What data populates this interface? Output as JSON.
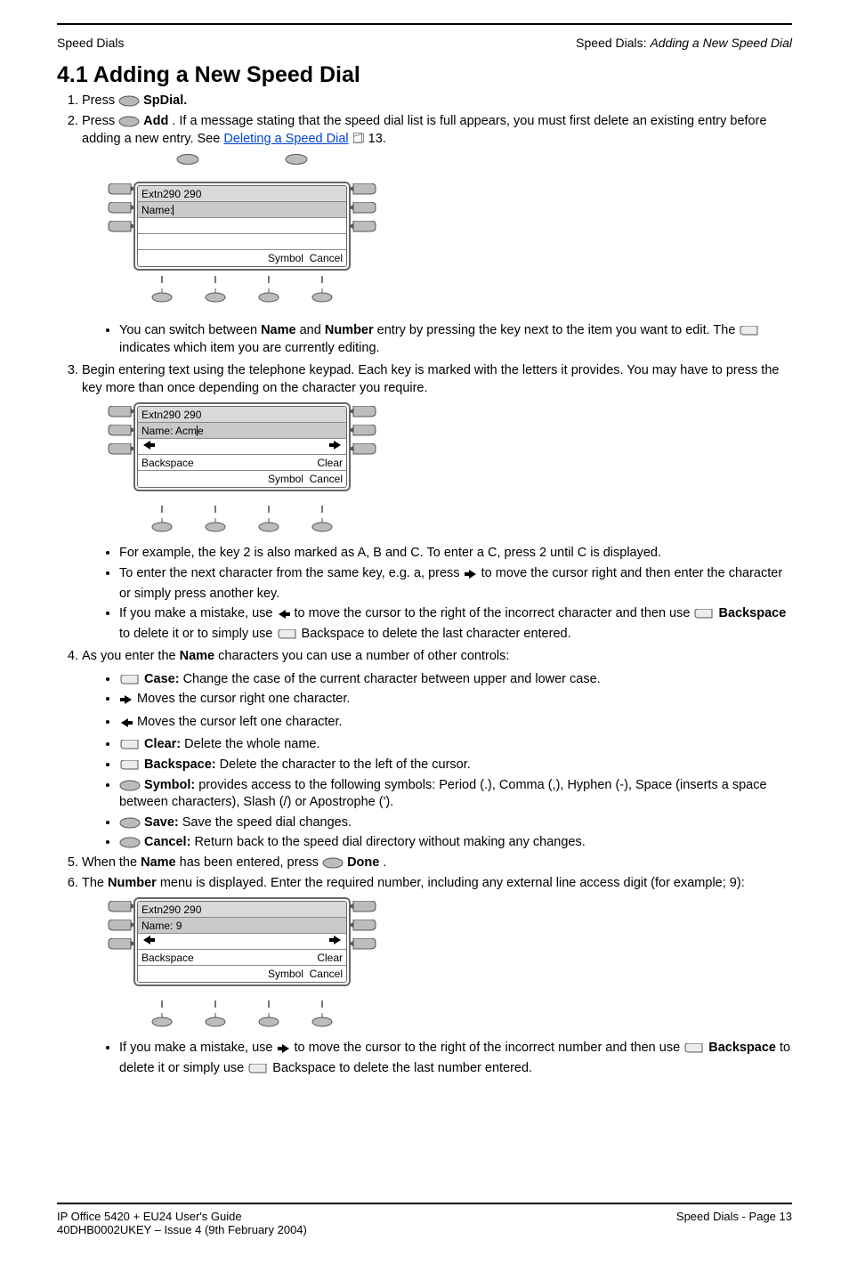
{
  "header": {
    "left": "Speed Dials",
    "right_prefix": "Speed Dials: ",
    "right_em": "Adding a New Speed Dial"
  },
  "title": "4.1 Adding a New Speed Dial",
  "step1": {
    "label": "Press ",
    "bold": "SpDial."
  },
  "step2": {
    "p1": "Press ",
    "add": "Add",
    "p2": ". If a message stating that the speed dial list is full appears, you must first delete an existing entry before adding a new entry. See ",
    "link": "Deleting a Speed Dial",
    "paren_open": " ",
    "page_ref": "."
  },
  "lcd1": {
    "row0": "Extn290 290",
    "row1": "Name:",
    "row4_l": "Symbol",
    "row4_r": "Cancel"
  },
  "step2b": {
    "p1": "You can switch between ",
    "name": "Name",
    "and": " and ",
    "num": "Number",
    "p2": " entry by pressing the key next to the item you want to edit. The",
    "p3": " indicates which item you are currently editing."
  },
  "step3": {
    "intro": "Begin entering text using the telephone keypad. Each key is marked with the letters it provides. You may have to press the key more than once depending on the character you require.",
    "l1_intro_img_alt": "lcd name acme",
    "b1": "For example, the key 2 is also marked as A, B and C. To enter a C, press 2 until C is displayed.",
    "b2_a": "To enter the next character from the same key, e.g. a, press ",
    "b2_b": " to move the cursor right and then enter the character or simply press another key.",
    "b3_a": "If you make a mistake, use ",
    "b3_b": " to move the cursor to the right of the incorrect character and then use ",
    "b3_backspace": "Backspace",
    "b3_c": " to delete it or to simply use ",
    "b3_d": " Backspace to delete the last character entered."
  },
  "step4": {
    "intro": "As you enter the ",
    "name": "Name",
    "intro2": " characters you can use a number of other controls:",
    "case_label": "Case: ",
    "case_text": "Change the case of the current character between upper and lower case.",
    "right": " Moves the cursor right one character.",
    "left": " Moves the cursor left one character.",
    "clear_label": "Clear:",
    "clear_text": " Delete the whole name.",
    "backspace_label": "Backspace:",
    "backspace_text": " Delete the character to the left of the cursor.",
    "symbol_label": "Symbol:",
    "symbol_text": " provides access to the following symbols: Period (.), Comma (,), Hyphen (-), Space (inserts a space between characters), Slash (/) or Apostrophe (').",
    "save_label": "Save:",
    "save_text": " Save the speed dial changes.",
    "cancel_label": "Cancel:",
    "cancel_text": " Return back to the speed dial directory without making any changes."
  },
  "step5": {
    "p1": "When the ",
    "name": "Name",
    "p2": " has been entered, press ",
    "done": " Done",
    "p3": "."
  },
  "step6": {
    "p1": "The ",
    "num": "Number",
    "p2": " menu is displayed. Enter the required number, including any external line access digit (for example; 9):"
  },
  "lcd3": {
    "row0": "Extn290 290",
    "row1_label": "Name:",
    "row1_val": "9",
    "row4_l": "Symbol",
    "row4_r": "Cancel"
  },
  "step6_bullets": {
    "b1_a": "If you make a mistake, use ",
    "b1_b": " to move the cursor to the right of the incorrect number and then use ",
    "b1_bs": "Backspace",
    "b1_c": " to delete it or simply use ",
    "b1_d": " Backspace to delete the last number entered."
  },
  "lcd2": {
    "row0": "Extn290 290",
    "row1_label": "Name:",
    "row1_val": "Acm",
    "row1_cursor_after": "e",
    "row3_l": "Backspace",
    "row3_r": "Clear",
    "row4_l": "Symbol",
    "row4_r": "Cancel"
  },
  "footer": {
    "left": "IP Office 5420 + EU24 User's Guide",
    "center": "Page 13",
    "right_a": "40DHB0002UKEY – Issue 4 (9th February 2004)",
    "right_b": "Speed Dials - Page 13"
  }
}
